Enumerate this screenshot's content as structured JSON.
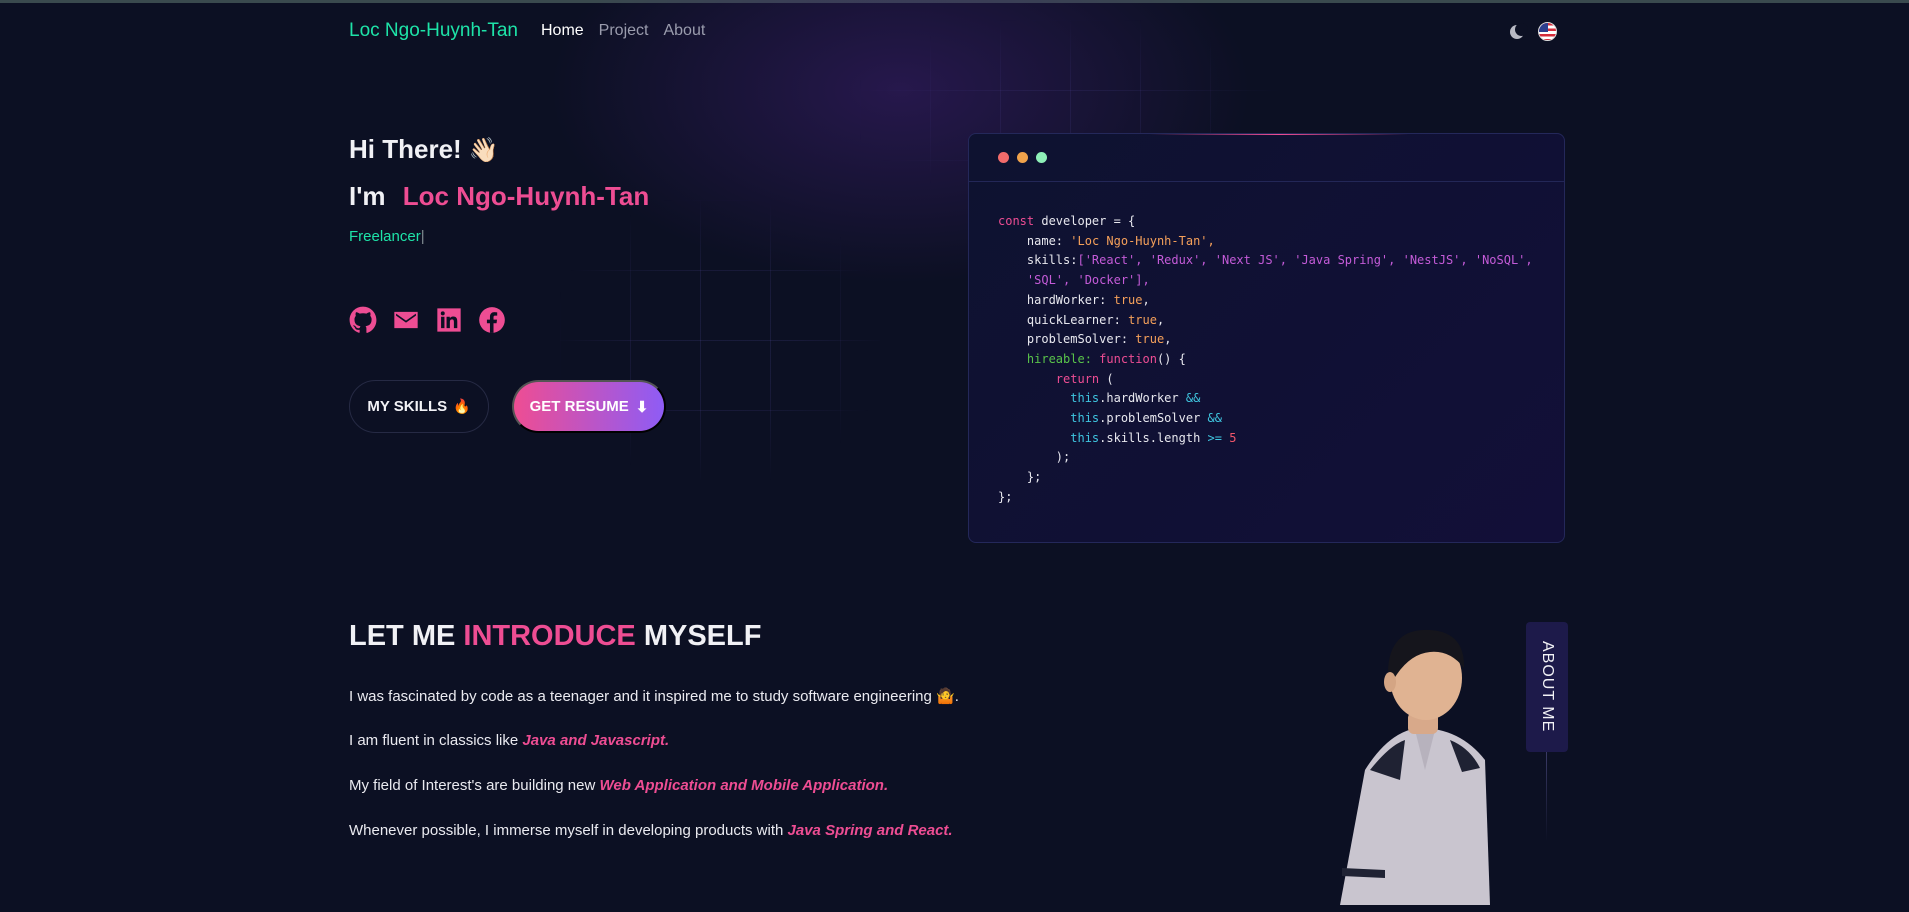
{
  "nav": {
    "brand": "Loc Ngo-Huynh-Tan",
    "links": [
      "Home",
      "Project",
      "About"
    ],
    "active": "Home"
  },
  "hero": {
    "greeting": "Hi There!",
    "greeting_emoji": "👋🏻",
    "im_prefix": "I'm",
    "name": "Loc Ngo-Huynh-Tan",
    "typed_role": "Freelancer",
    "typed_cursor": "|",
    "socials": [
      "github-icon",
      "mail-icon",
      "linkedin-icon",
      "facebook-icon"
    ],
    "skills_button": "MY SKILLS",
    "skills_emoji": "🔥",
    "resume_button": "GET RESUME",
    "resume_icon": "⬇"
  },
  "code_card": {
    "dot_colors": [
      "#f26b6b",
      "#f0a24b",
      "#8ef0b8"
    ],
    "line1_kw": "const",
    "line1_rest": " developer = {",
    "name_key": "name: ",
    "name_val": "'Loc Ngo-Huynh-Tan',",
    "skills_key": "skills:",
    "skills_val1": "['React', 'Redux', 'Next JS', 'Java Spring', 'NestJS', 'NoSQL',",
    "skills_val2": "'SQL', 'Docker'],",
    "hard_key": "hardWorker: ",
    "hard_val": "true",
    "quick_key": "quickLearner: ",
    "quick_val": "true",
    "prob_key": "problemSolver: ",
    "prob_val": "true",
    "hire_key": "hireable: ",
    "hire_fn": "function",
    "hire_rest": "() {",
    "ret_kw": "return",
    "ret_rest": " (",
    "c1_this": "this",
    "c1_rest": ".hardWorker ",
    "c1_op": "&&",
    "c2_this": "this",
    "c2_rest": ".problemSolver ",
    "c2_op": "&&",
    "c3_this": "this",
    "c3_rest": ".skills.length ",
    "c3_op": ">=",
    "c3_num": " 5",
    "close1": ");",
    "close2": "};",
    "close3": "};"
  },
  "intro": {
    "title_a": "LET ME ",
    "title_hl": "INTRODUCE",
    "title_b": " MYSELF",
    "p1": "I was fascinated by code as a teenager and it inspired me to study software engineering",
    "p1_emoji": "🤷",
    "p1_end": ".",
    "p2": "I am fluent in classics like ",
    "p2_em": "Java and Javascript.",
    "p3": "My field of Interest's are building new ",
    "p3_em": "Web Application and Mobile Application.",
    "p4": "Whenever possible, I immerse myself in developing products with ",
    "p4_em": "Java Spring and React.",
    "about_tab": "ABOUT ME"
  }
}
